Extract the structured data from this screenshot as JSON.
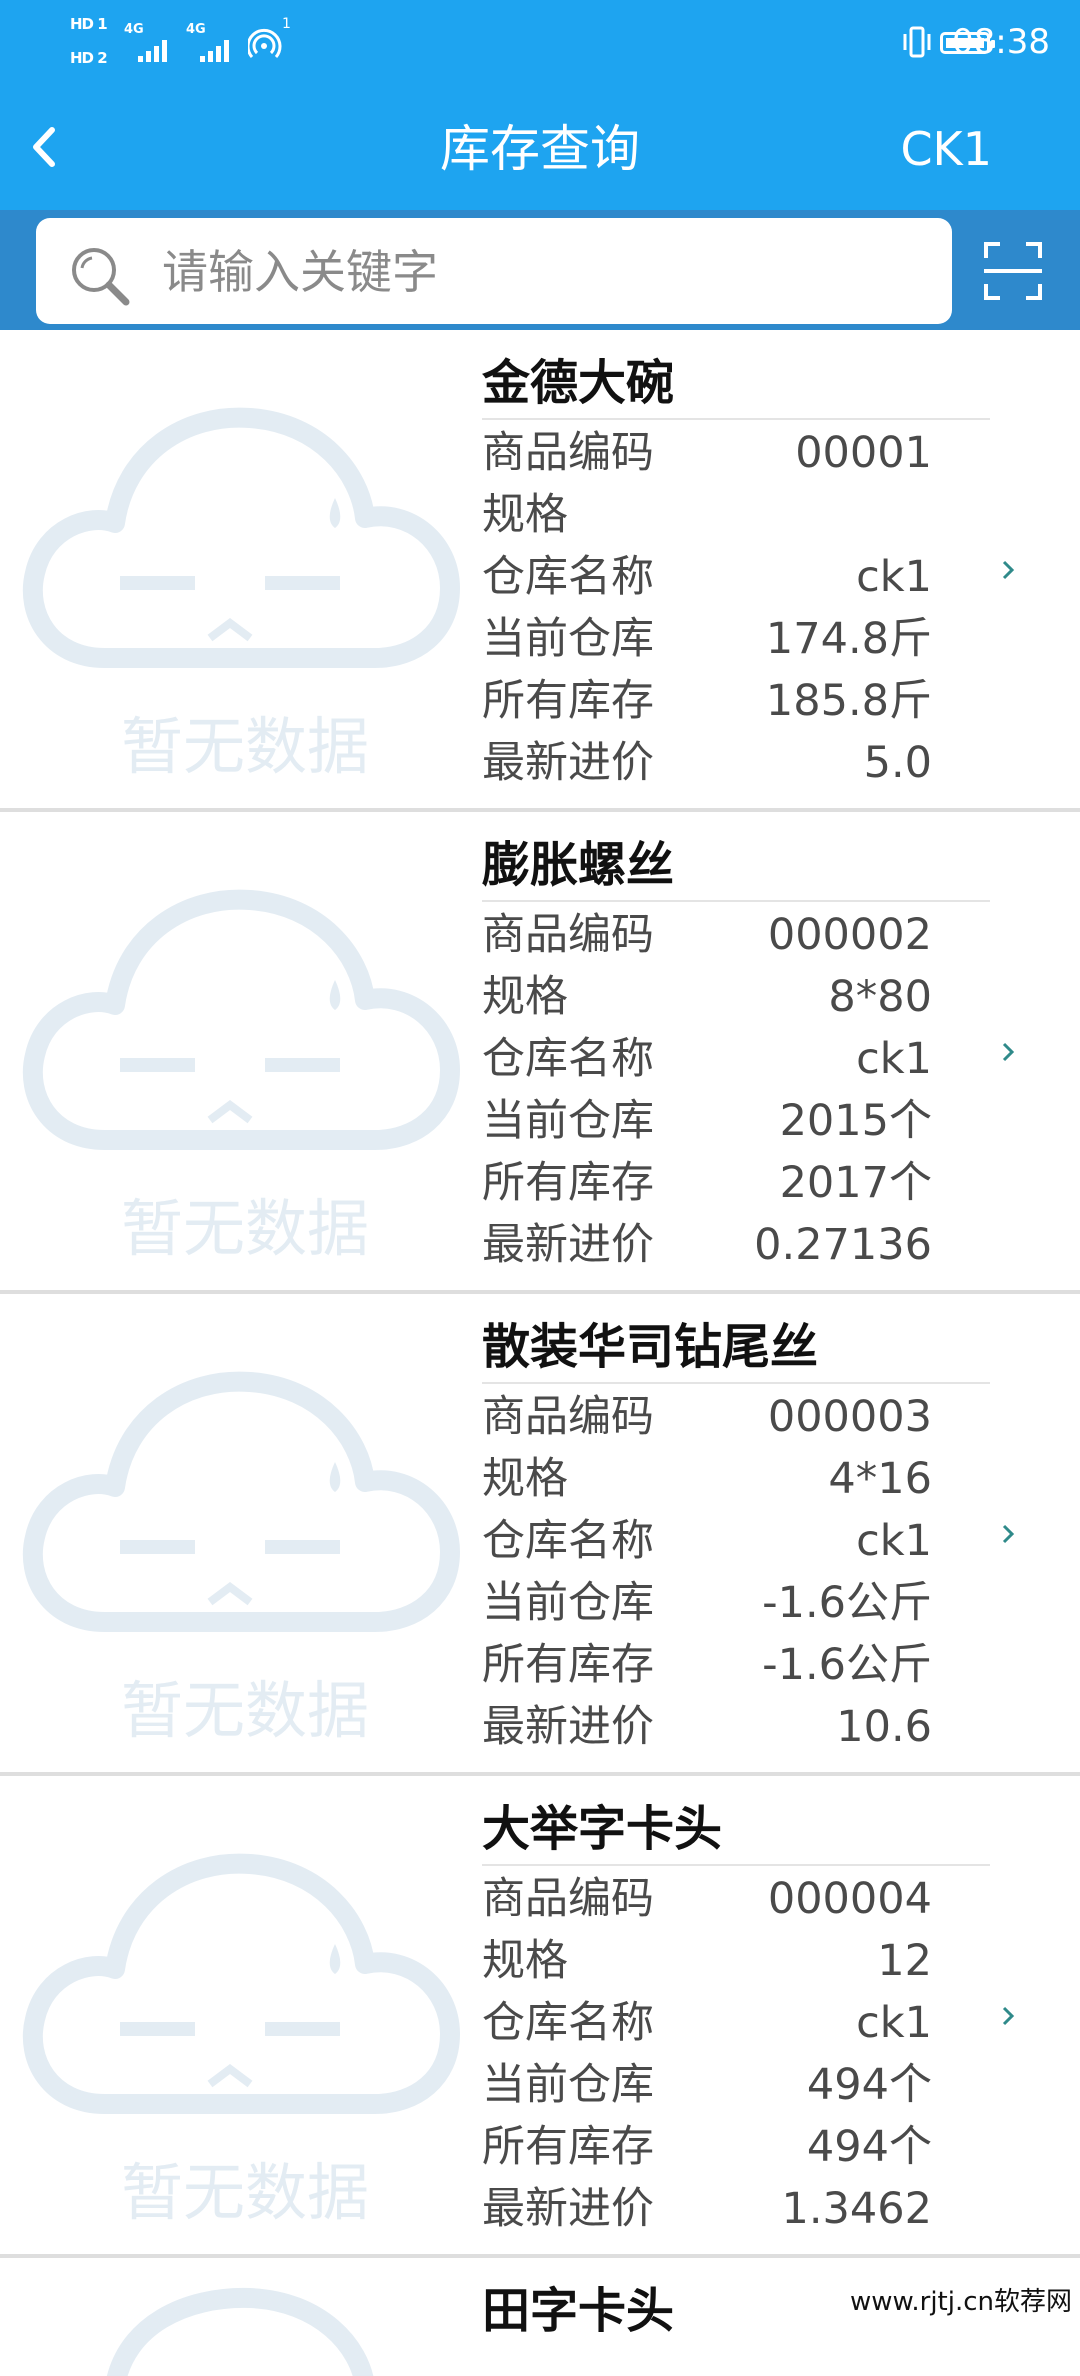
{
  "status_bar": {
    "sim1": "HD 1",
    "sim2": "HD 2",
    "network1": "4G",
    "network2": "4G",
    "hotspot_count": "1",
    "time": "08:38"
  },
  "header": {
    "title": "库存查询",
    "warehouse_button": "CK1"
  },
  "search": {
    "placeholder": "请输入关键字",
    "value": ""
  },
  "icons": {
    "back": "chevron-left-icon",
    "search": "magnifier-icon",
    "scan": "scan-icon",
    "item_arrow": "chevron-right-icon",
    "placeholder": "cloud-placeholder-icon"
  },
  "colors": {
    "header_bg": "#1ea4f0",
    "search_bar_bg": "#2e89cc",
    "placeholder": "#e3ecf3",
    "chevron": "#2f8a8a"
  },
  "placeholder_text": "暂无数据",
  "labels": {
    "code": "商品编码",
    "spec": "规格",
    "warehouse": "仓库名称",
    "current_stock": "当前仓库",
    "total_stock": "所有库存",
    "latest_price": "最新进价"
  },
  "items": [
    {
      "name": "金德大碗",
      "code": "00001",
      "spec": "",
      "warehouse": "ck1",
      "current_stock": "174.8斤",
      "total_stock": "185.8斤",
      "latest_price": "5.0"
    },
    {
      "name": "膨胀螺丝",
      "code": "000002",
      "spec": "8*80",
      "warehouse": "ck1",
      "current_stock": "2015个",
      "total_stock": "2017个",
      "latest_price": "0.27136"
    },
    {
      "name": "散装华司钻尾丝",
      "code": "000003",
      "spec": "4*16",
      "warehouse": "ck1",
      "current_stock": "-1.6公斤",
      "total_stock": "-1.6公斤",
      "latest_price": "10.6"
    },
    {
      "name": "大举字卡头",
      "code": "000004",
      "spec": "12",
      "warehouse": "ck1",
      "current_stock": "494个",
      "total_stock": "494个",
      "latest_price": "1.3462"
    },
    {
      "name": "田字卡头"
    }
  ],
  "watermark": "www.rjtj.cn软荐网"
}
